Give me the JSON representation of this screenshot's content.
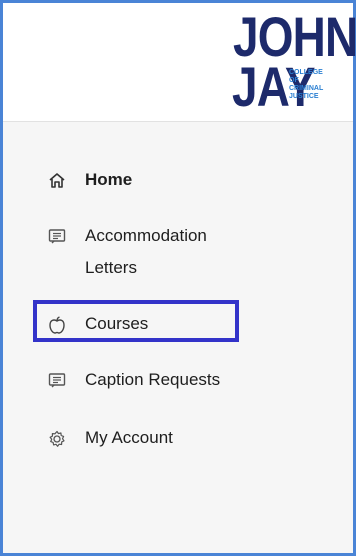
{
  "logo": {
    "line1": "JOHN",
    "line2": "JAY",
    "sub": [
      "COLLEGE",
      "OF",
      "CRIMINAL",
      "JUSTICE"
    ]
  },
  "nav": {
    "home": {
      "label": "Home",
      "icon": "home-icon"
    },
    "accommodation": {
      "label_line1": "Accommodation",
      "label_line2": "Letters",
      "icon": "message-icon"
    },
    "courses": {
      "label": "Courses",
      "icon": "apple-icon"
    },
    "caption": {
      "label": "Caption Requests",
      "icon": "message-icon"
    },
    "account": {
      "label": "My Account",
      "icon": "gear-icon"
    }
  },
  "colors": {
    "logo_dark": "#1d2a6b",
    "logo_accent": "#2a7fd2",
    "frame": "#4a84d6",
    "highlight": "#3333c9",
    "sidebar_bg": "#f6f6f6"
  }
}
